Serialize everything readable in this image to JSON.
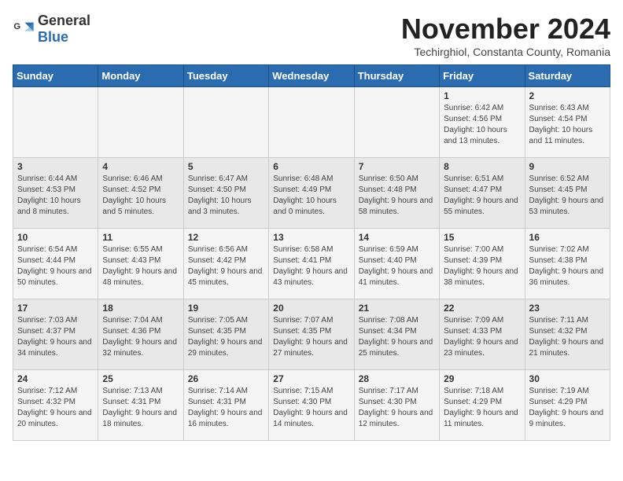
{
  "logo": {
    "general": "General",
    "blue": "Blue"
  },
  "title": "November 2024",
  "subtitle": "Techirghiol, Constanta County, Romania",
  "days_of_week": [
    "Sunday",
    "Monday",
    "Tuesday",
    "Wednesday",
    "Thursday",
    "Friday",
    "Saturday"
  ],
  "weeks": [
    [
      {
        "day": "",
        "info": ""
      },
      {
        "day": "",
        "info": ""
      },
      {
        "day": "",
        "info": ""
      },
      {
        "day": "",
        "info": ""
      },
      {
        "day": "",
        "info": ""
      },
      {
        "day": "1",
        "info": "Sunrise: 6:42 AM\nSunset: 4:56 PM\nDaylight: 10 hours and 13 minutes."
      },
      {
        "day": "2",
        "info": "Sunrise: 6:43 AM\nSunset: 4:54 PM\nDaylight: 10 hours and 11 minutes."
      }
    ],
    [
      {
        "day": "3",
        "info": "Sunrise: 6:44 AM\nSunset: 4:53 PM\nDaylight: 10 hours and 8 minutes."
      },
      {
        "day": "4",
        "info": "Sunrise: 6:46 AM\nSunset: 4:52 PM\nDaylight: 10 hours and 5 minutes."
      },
      {
        "day": "5",
        "info": "Sunrise: 6:47 AM\nSunset: 4:50 PM\nDaylight: 10 hours and 3 minutes."
      },
      {
        "day": "6",
        "info": "Sunrise: 6:48 AM\nSunset: 4:49 PM\nDaylight: 10 hours and 0 minutes."
      },
      {
        "day": "7",
        "info": "Sunrise: 6:50 AM\nSunset: 4:48 PM\nDaylight: 9 hours and 58 minutes."
      },
      {
        "day": "8",
        "info": "Sunrise: 6:51 AM\nSunset: 4:47 PM\nDaylight: 9 hours and 55 minutes."
      },
      {
        "day": "9",
        "info": "Sunrise: 6:52 AM\nSunset: 4:45 PM\nDaylight: 9 hours and 53 minutes."
      }
    ],
    [
      {
        "day": "10",
        "info": "Sunrise: 6:54 AM\nSunset: 4:44 PM\nDaylight: 9 hours and 50 minutes."
      },
      {
        "day": "11",
        "info": "Sunrise: 6:55 AM\nSunset: 4:43 PM\nDaylight: 9 hours and 48 minutes."
      },
      {
        "day": "12",
        "info": "Sunrise: 6:56 AM\nSunset: 4:42 PM\nDaylight: 9 hours and 45 minutes."
      },
      {
        "day": "13",
        "info": "Sunrise: 6:58 AM\nSunset: 4:41 PM\nDaylight: 9 hours and 43 minutes."
      },
      {
        "day": "14",
        "info": "Sunrise: 6:59 AM\nSunset: 4:40 PM\nDaylight: 9 hours and 41 minutes."
      },
      {
        "day": "15",
        "info": "Sunrise: 7:00 AM\nSunset: 4:39 PM\nDaylight: 9 hours and 38 minutes."
      },
      {
        "day": "16",
        "info": "Sunrise: 7:02 AM\nSunset: 4:38 PM\nDaylight: 9 hours and 36 minutes."
      }
    ],
    [
      {
        "day": "17",
        "info": "Sunrise: 7:03 AM\nSunset: 4:37 PM\nDaylight: 9 hours and 34 minutes."
      },
      {
        "day": "18",
        "info": "Sunrise: 7:04 AM\nSunset: 4:36 PM\nDaylight: 9 hours and 32 minutes."
      },
      {
        "day": "19",
        "info": "Sunrise: 7:05 AM\nSunset: 4:35 PM\nDaylight: 9 hours and 29 minutes."
      },
      {
        "day": "20",
        "info": "Sunrise: 7:07 AM\nSunset: 4:35 PM\nDaylight: 9 hours and 27 minutes."
      },
      {
        "day": "21",
        "info": "Sunrise: 7:08 AM\nSunset: 4:34 PM\nDaylight: 9 hours and 25 minutes."
      },
      {
        "day": "22",
        "info": "Sunrise: 7:09 AM\nSunset: 4:33 PM\nDaylight: 9 hours and 23 minutes."
      },
      {
        "day": "23",
        "info": "Sunrise: 7:11 AM\nSunset: 4:32 PM\nDaylight: 9 hours and 21 minutes."
      }
    ],
    [
      {
        "day": "24",
        "info": "Sunrise: 7:12 AM\nSunset: 4:32 PM\nDaylight: 9 hours and 20 minutes."
      },
      {
        "day": "25",
        "info": "Sunrise: 7:13 AM\nSunset: 4:31 PM\nDaylight: 9 hours and 18 minutes."
      },
      {
        "day": "26",
        "info": "Sunrise: 7:14 AM\nSunset: 4:31 PM\nDaylight: 9 hours and 16 minutes."
      },
      {
        "day": "27",
        "info": "Sunrise: 7:15 AM\nSunset: 4:30 PM\nDaylight: 9 hours and 14 minutes."
      },
      {
        "day": "28",
        "info": "Sunrise: 7:17 AM\nSunset: 4:30 PM\nDaylight: 9 hours and 12 minutes."
      },
      {
        "day": "29",
        "info": "Sunrise: 7:18 AM\nSunset: 4:29 PM\nDaylight: 9 hours and 11 minutes."
      },
      {
        "day": "30",
        "info": "Sunrise: 7:19 AM\nSunset: 4:29 PM\nDaylight: 9 hours and 9 minutes."
      }
    ]
  ]
}
